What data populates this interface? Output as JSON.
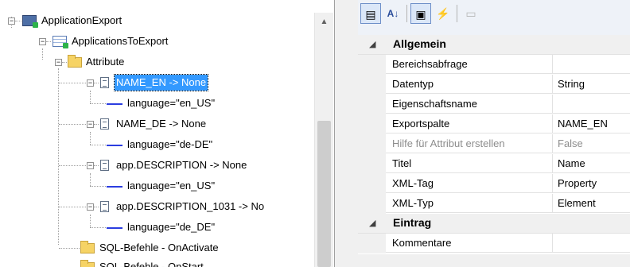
{
  "tree": {
    "nodes": [
      {
        "label": "ApplicationExport",
        "icon": "application-icon",
        "expander": "−"
      },
      {
        "label": "ApplicationsToExport",
        "icon": "grid-icon",
        "expander": "−"
      },
      {
        "label": "Attribute",
        "icon": "folder-icon",
        "expander": "−"
      },
      {
        "label": "NAME_EN -> None",
        "icon": "document-icon",
        "expander": "−",
        "selected": true
      },
      {
        "label": "language=\"en_US\"",
        "icon": "property-icon"
      },
      {
        "label": "NAME_DE -> None",
        "icon": "document-icon",
        "expander": "−"
      },
      {
        "label": "language=\"de-DE\"",
        "icon": "property-icon"
      },
      {
        "label": "app.DESCRIPTION -> None",
        "icon": "document-icon",
        "expander": "−"
      },
      {
        "label": "language=\"en_US\"",
        "icon": "property-icon"
      },
      {
        "label": "app.DESCRIPTION_1031 -> No",
        "icon": "document-icon",
        "expander": "−"
      },
      {
        "label": "language=\"de_DE\"",
        "icon": "property-icon"
      },
      {
        "label": "SQL-Befehle - OnActivate",
        "icon": "folder-icon"
      },
      {
        "label": "SQL-Befehle - OnStart",
        "icon": "folder-icon"
      }
    ],
    "scroll_up_glyph": "▲"
  },
  "toolbar": {
    "categorized_glyph": "▤",
    "alphabetical_glyph": "A↓",
    "properties_glyph": "▣",
    "events_glyph": "⚡",
    "pages_glyph": "▭"
  },
  "property_grid": {
    "categories": [
      {
        "name": "Allgemein",
        "collapse_glyph": "◢",
        "rows": [
          {
            "key": "Bereichsabfrage",
            "value": ""
          },
          {
            "key": "Datentyp",
            "value": "String"
          },
          {
            "key": "Eigenschaftsname",
            "value": ""
          },
          {
            "key": "Exportspalte",
            "value": "NAME_EN"
          },
          {
            "key": "Hilfe für Attribut erstellen",
            "value": "False",
            "disabled": true
          },
          {
            "key": "Titel",
            "value": "Name"
          },
          {
            "key": "XML-Tag",
            "value": "Property"
          },
          {
            "key": "XML-Typ",
            "value": "Element"
          }
        ]
      },
      {
        "name": "Eintrag",
        "collapse_glyph": "◢",
        "rows": [
          {
            "key": "Kommentare",
            "value": ""
          }
        ]
      }
    ]
  },
  "colors": {
    "selection": "#3399ff",
    "gutter": "#f0f0f0",
    "disabled_text": "#8d8d8d"
  }
}
